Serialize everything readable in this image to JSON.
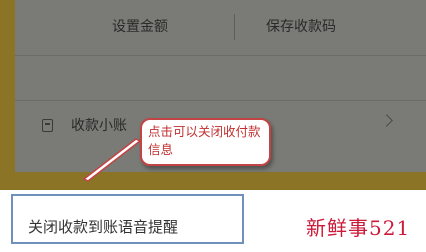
{
  "actions": {
    "set_amount": "设置金额",
    "save_code": "保存收款码"
  },
  "mini_row": {
    "label": "收款小账",
    "icon": "document-icon"
  },
  "callout": {
    "text": "点击可以关闭收付款信息"
  },
  "bottom": {
    "label": "关闭收款到账语音提醒"
  },
  "watermark": {
    "text": "新鲜事521"
  },
  "colors": {
    "highlight": "#6f8fbd",
    "callout_border": "#c24444",
    "watermark": "#cc1a3a"
  }
}
